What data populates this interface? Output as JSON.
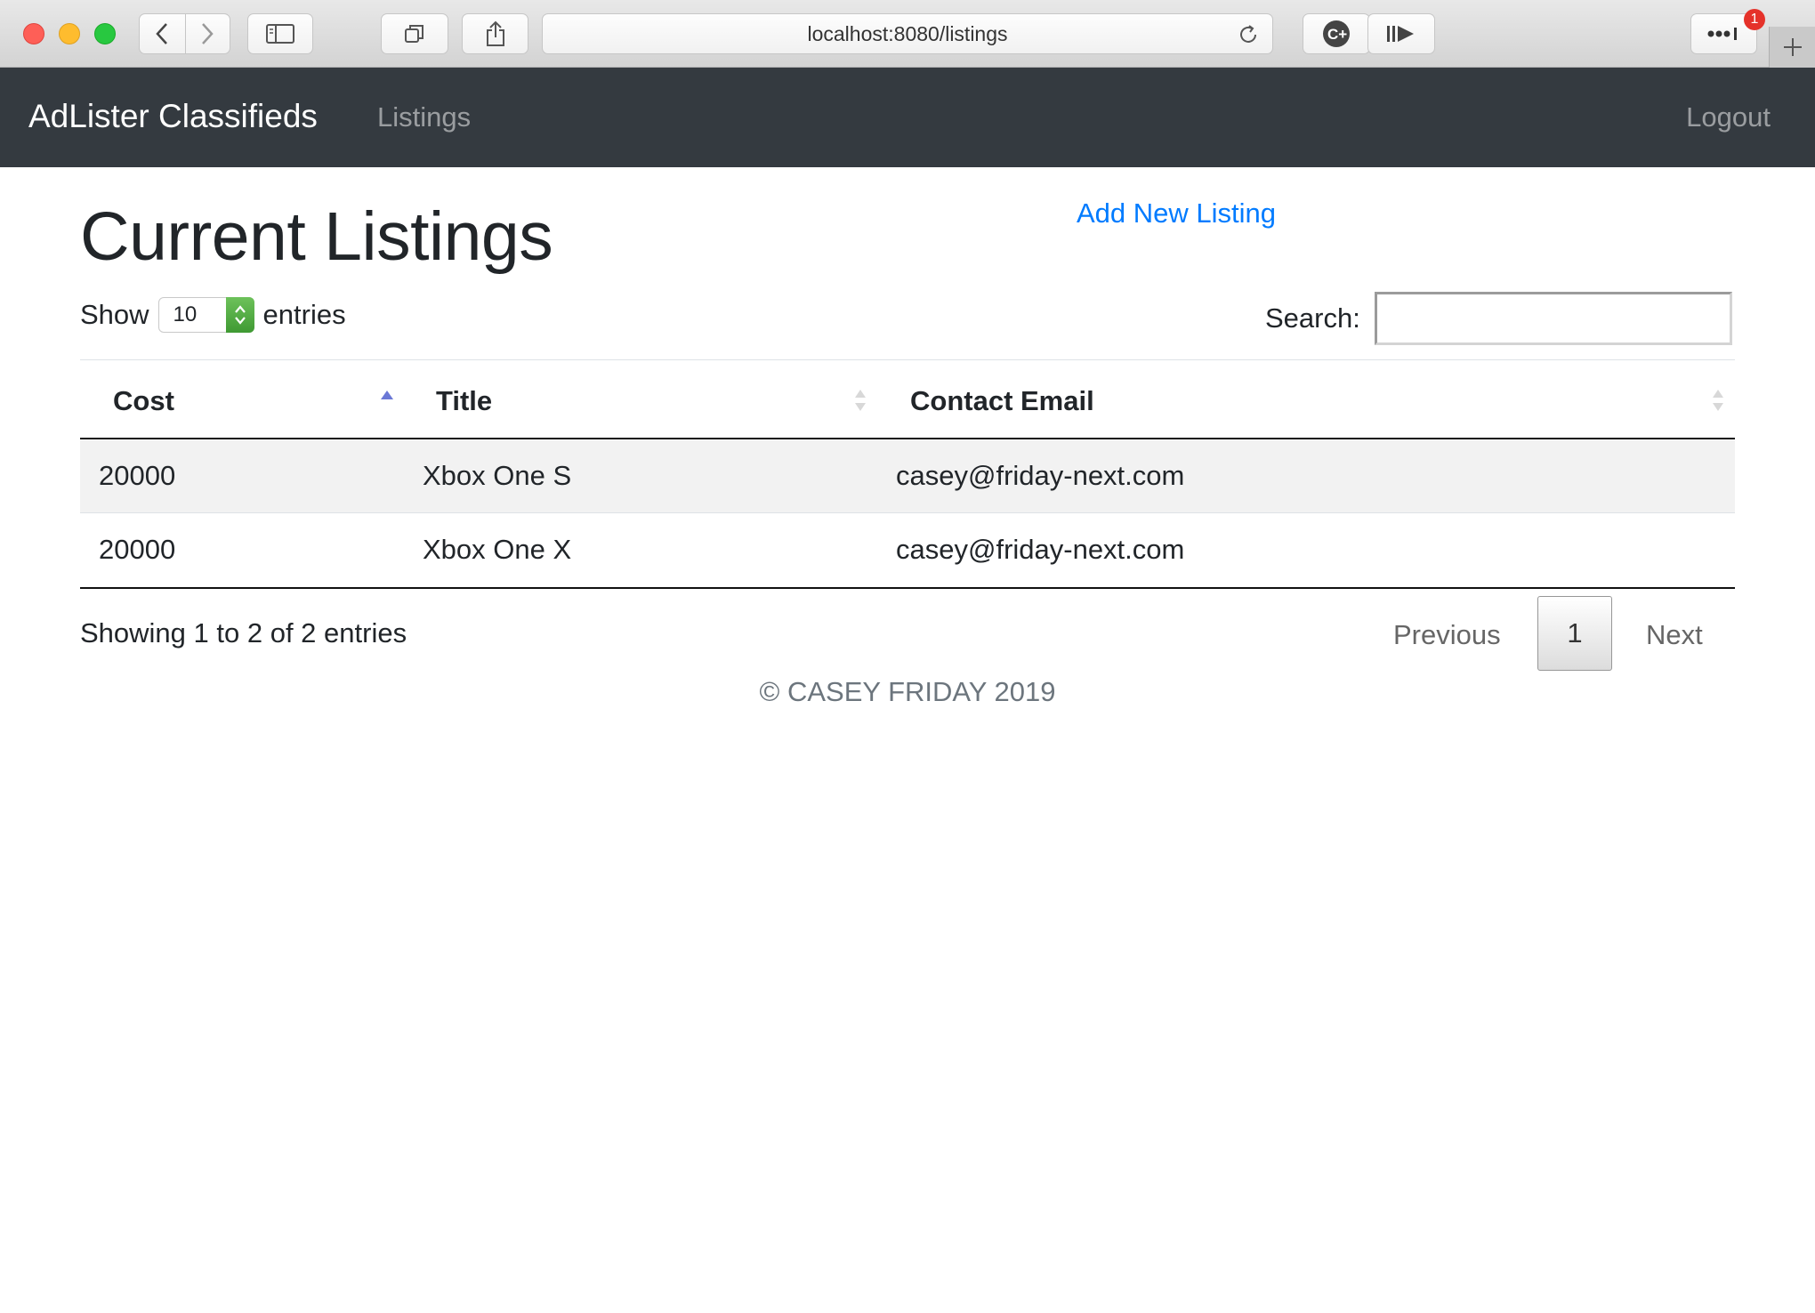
{
  "browser": {
    "url": "localhost:8080/listings",
    "notification_count": "1"
  },
  "navbar": {
    "brand": "AdLister Classifieds",
    "listings": "Listings",
    "logout": "Logout"
  },
  "page": {
    "title": "Current Listings",
    "add_link": "Add New Listing"
  },
  "table_controls": {
    "show_label": "Show",
    "page_length": "10",
    "entries_label": "entries",
    "search_label": "Search:",
    "search_value": ""
  },
  "table": {
    "headers": [
      "Cost",
      "Title",
      "Contact Email"
    ],
    "sorted_column": "Cost",
    "sort_direction": "ascending",
    "rows": [
      [
        "20000",
        "Xbox One S",
        "casey@friday-next.com"
      ],
      [
        "20000",
        "Xbox One X",
        "casey@friday-next.com"
      ]
    ]
  },
  "pagination": {
    "info": "Showing 1 to 2 of 2 entries",
    "previous": "Previous",
    "current_page": "1",
    "next": "Next"
  },
  "footer": {
    "text": "© CASEY FRIDAY 2019"
  },
  "colors": {
    "navbar_bg": "#343a40",
    "link": "#007bff",
    "sort_active": "#6b78d6"
  }
}
